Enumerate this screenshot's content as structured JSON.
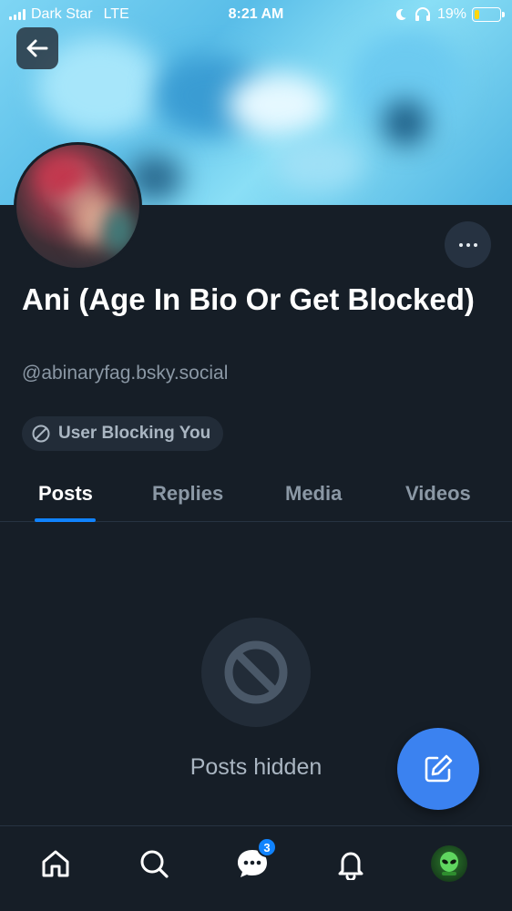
{
  "status_bar": {
    "carrier": "Dark Star",
    "network": "LTE",
    "time": "8:21 AM",
    "battery_percent": "19%",
    "battery_level": 0.19,
    "battery_color": "#ffd60a"
  },
  "profile": {
    "display_name": "Ani (Age In Bio Or Get Blocked)",
    "handle": "@abinaryfag.bsky.social",
    "blocking_badge": "User Blocking You"
  },
  "tabs": [
    {
      "label": "Posts",
      "active": true
    },
    {
      "label": "Replies",
      "active": false
    },
    {
      "label": "Media",
      "active": false
    },
    {
      "label": "Videos",
      "active": false
    }
  ],
  "empty_state": {
    "message": "Posts hidden",
    "icon": "block-icon"
  },
  "bottom_nav": {
    "items": [
      {
        "icon": "home-icon"
      },
      {
        "icon": "search-icon"
      },
      {
        "icon": "chat-icon",
        "badge": "3"
      },
      {
        "icon": "bell-icon"
      },
      {
        "icon": "profile-avatar"
      }
    ]
  },
  "colors": {
    "background": "#161e27",
    "accent": "#1083fe",
    "fab": "#3b82f0",
    "muted_text": "#8b98a5"
  }
}
